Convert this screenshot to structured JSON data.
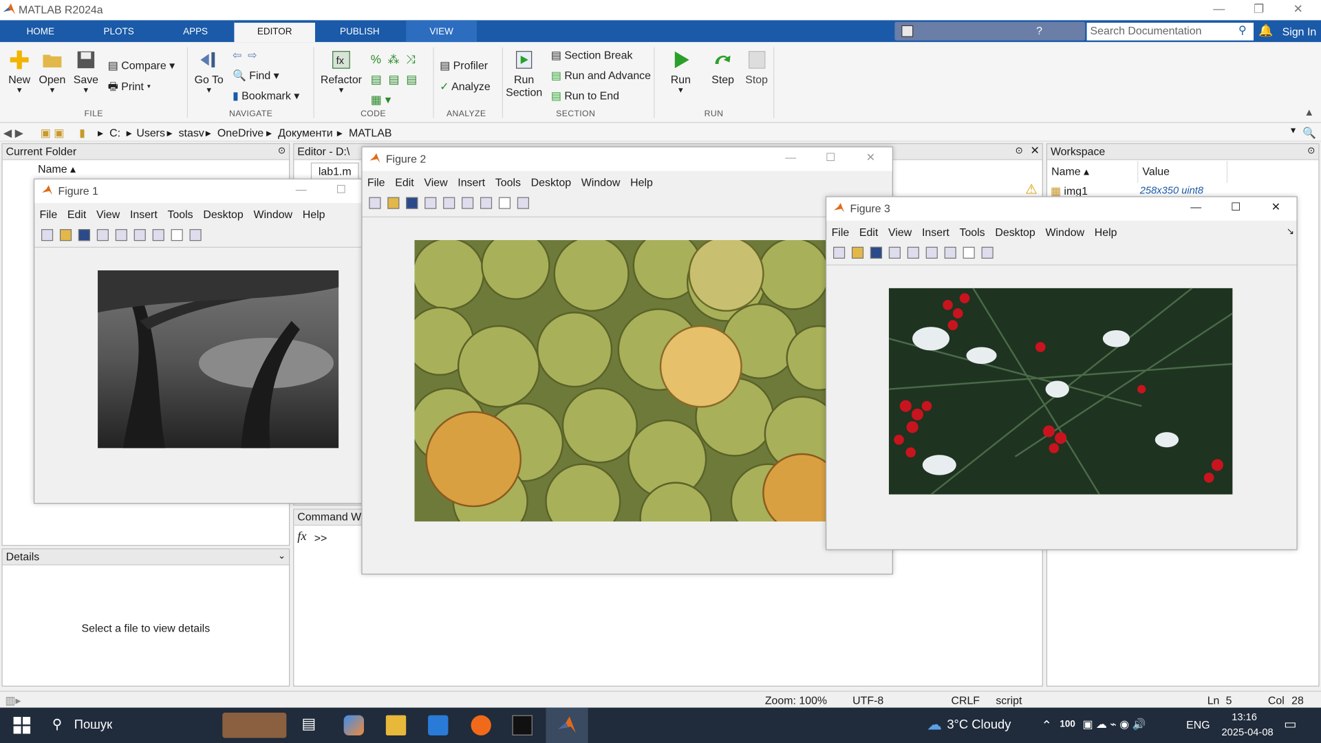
{
  "window": {
    "title": "MATLAB R2024a"
  },
  "tabs": [
    "HOME",
    "PLOTS",
    "APPS",
    "EDITOR",
    "PUBLISH",
    "VIEW"
  ],
  "search": {
    "placeholder": "Search Documentation"
  },
  "account": {
    "signin": "Sign In"
  },
  "ribbon": {
    "file": {
      "new": "New",
      "open": "Open",
      "save": "Save",
      "compare": "Compare",
      "print": "Print",
      "group": "FILE"
    },
    "navigate": {
      "goto": "Go To",
      "find": "Find",
      "bookmark": "Bookmark",
      "group": "NAVIGATE"
    },
    "code": {
      "refactor": "Refactor",
      "group": "CODE"
    },
    "analyze": {
      "profiler": "Profiler",
      "analyze": "Analyze",
      "group": "ANALYZE"
    },
    "section": {
      "run_section": "Run",
      "run_section2": "Section",
      "section_break": "Section Break",
      "run_advance": "Run and Advance",
      "run_end": "Run to End",
      "group": "SECTION"
    },
    "run": {
      "run": "Run",
      "step": "Step",
      "stop": "Stop",
      "group": "RUN"
    }
  },
  "address": {
    "parts": [
      "C:",
      "Users",
      "stasv",
      "OneDrive",
      "Документи",
      "MATLAB"
    ]
  },
  "current_folder": {
    "title": "Current Folder",
    "col_name": "Name"
  },
  "details": {
    "title": "Details",
    "message": "Select a file to view details"
  },
  "editor": {
    "title": "Editor - D:\\",
    "tab": "lab1.m"
  },
  "command": {
    "title": "Command Wi",
    "fx": "fx",
    "prompt": ">>"
  },
  "workspace": {
    "title": "Workspace",
    "col_name": "Name",
    "col_value": "Value",
    "rows": [
      {
        "name": "img1",
        "value": "258x350 uint8"
      }
    ]
  },
  "figures": {
    "f1": {
      "title": "Figure 1"
    },
    "f2": {
      "title": "Figure 2"
    },
    "f3": {
      "title": "Figure 3"
    },
    "menu": [
      "File",
      "Edit",
      "View",
      "Insert",
      "Tools",
      "Desktop",
      "Window",
      "Help"
    ]
  },
  "status": {
    "zoom": "Zoom: 100%",
    "encoding": "UTF-8",
    "eol": "CRLF",
    "mode": "script",
    "ln_label": "Ln",
    "ln": "5",
    "col_label": "Col",
    "col": "28"
  },
  "taskbar": {
    "search": "Пошук",
    "weather": "3°C  Cloudy",
    "battery": "100",
    "lang": "ENG",
    "time": "13:16",
    "date": "2025-04-08"
  },
  "colors": {
    "tabbar": "#1a5aa8",
    "taskbar": "#202b3b",
    "run_green": "#2aa02a"
  }
}
